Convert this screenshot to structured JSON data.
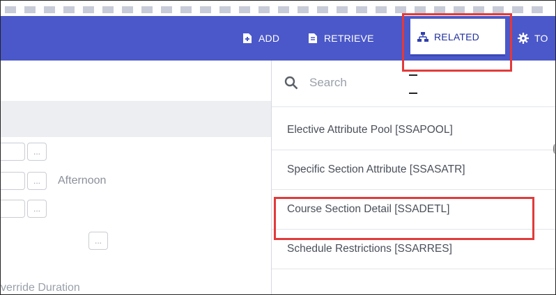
{
  "toolbar": {
    "add_label": "ADD",
    "retrieve_label": "RETRIEVE",
    "related_label": "RELATED",
    "tools_label": "TO",
    "bg_color": "#4b58c9"
  },
  "form": {
    "afternoon_label": "Afternoon",
    "override_label": "verride Duration",
    "lookup_glyph": "..."
  },
  "related_menu": {
    "search_placeholder": "Search",
    "items": [
      {
        "label": "Elective Attribute Pool [SSAPOOL]"
      },
      {
        "label": "Specific Section Attribute [SSASATR]"
      },
      {
        "label": "Course Section Detail [SSADETL]"
      },
      {
        "label": "Schedule Restrictions [SSARRES]"
      }
    ]
  },
  "icons": {
    "add": "add-document-icon",
    "retrieve": "retrieve-document-icon",
    "related": "sitemap-icon",
    "tools": "gear-icon",
    "search": "search-icon"
  },
  "highlight_color": "#e23a3a"
}
